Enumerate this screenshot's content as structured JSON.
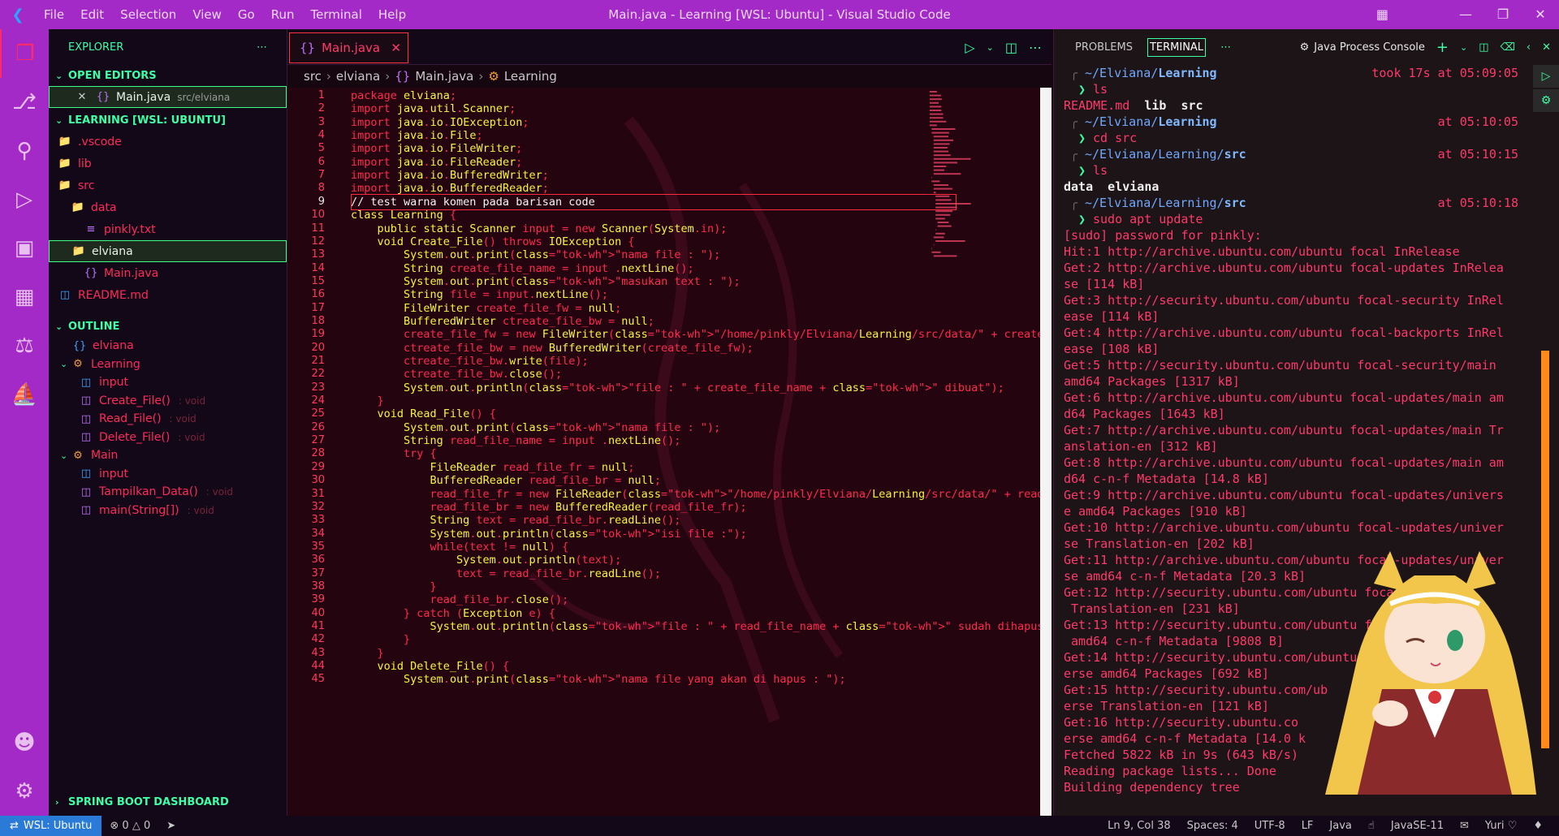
{
  "titlebar": {
    "menu": [
      "File",
      "Edit",
      "Selection",
      "View",
      "Go",
      "Run",
      "Terminal",
      "Help"
    ],
    "title": "Main.java - Learning [WSL: Ubuntu] - Visual Studio Code"
  },
  "sidebar": {
    "header": "EXPLORER",
    "open_editors": {
      "title": "OPEN EDITORS",
      "items": [
        {
          "name": "Main.java",
          "path": "src/elviana"
        }
      ]
    },
    "workspace": {
      "title": "LEARNING [WSL: UBUNTU]",
      "items": [
        {
          "label": ".vscode",
          "depth": 0
        },
        {
          "label": "lib",
          "depth": 0
        },
        {
          "label": "src",
          "depth": 0
        },
        {
          "label": "data",
          "depth": 1
        },
        {
          "label": "pinkly.txt",
          "depth": 2
        },
        {
          "label": "elviana",
          "depth": 1
        },
        {
          "label": "Main.java",
          "depth": 2
        },
        {
          "label": "README.md",
          "depth": 0
        }
      ]
    },
    "outline": {
      "title": "OUTLINE",
      "items": [
        {
          "label": "elviana",
          "type": ""
        },
        {
          "label": "Learning",
          "type": ""
        },
        {
          "label": "input",
          "type": ""
        },
        {
          "label": "Create_File()",
          "type": ": void"
        },
        {
          "label": "Read_File()",
          "type": ": void"
        },
        {
          "label": "Delete_File()",
          "type": ": void"
        },
        {
          "label": "Main",
          "type": ""
        },
        {
          "label": "input",
          "type": ""
        },
        {
          "label": "Tampilkan_Data()",
          "type": ": void"
        },
        {
          "label": "main(String[])",
          "type": ": void"
        }
      ]
    },
    "spring": "SPRING BOOT DASHBOARD"
  },
  "editor": {
    "tab": "Main.java",
    "breadcrumb": [
      "src",
      "elviana",
      "Main.java",
      "Learning"
    ],
    "current_line": 9,
    "lines": [
      "package elviana;",
      "import java.util.Scanner;",
      "import java.io.IOException;",
      "import java.io.File;",
      "import java.io.FileWriter;",
      "import java.io.FileReader;",
      "import java.io.BufferedWriter;",
      "import java.io.BufferedReader;",
      "// test warna komen pada barisan code",
      "class Learning {",
      "    public static Scanner input = new Scanner(System.in);",
      "    void Create_File() throws IOException {",
      "        System.out.print(\"nama file : \");",
      "        String create_file_name = input .nextLine();",
      "        System.out.print(\"masukan text : \");",
      "        String file = input.nextLine();",
      "        FileWriter create_file_fw = null;",
      "        BufferedWriter ctreate_file_bw = null;",
      "        create_file_fw = new FileWriter(\"/home/pinkly/Elviana/Learning/src/data/\" + create_",
      "        ctreate_file_bw = new BufferedWriter(create_file_fw);",
      "        ctreate_file_bw.write(file);",
      "        ctreate_file_bw.close();",
      "        System.out.println(\"file : \" + create_file_name + \" dibuat\");",
      "    }",
      "    void Read_File() {",
      "        System.out.print(\"nama file : \");",
      "        String read_file_name = input .nextLine();",
      "        try {",
      "            FileReader read_file_fr = null;",
      "            BufferedReader read_file_br = null;",
      "            read_file_fr = new FileReader(\"/home/pinkly/Elviana/Learning/src/data/\" + read_",
      "            read_file_br = new BufferedReader(read_file_fr);",
      "            String text = read_file_br.readLine();",
      "            System.out.println(\"isi file :\");",
      "            while(text != null) {",
      "                System.out.println(text);",
      "                text = read_file_br.readLine();",
      "            }",
      "            read_file_br.close();",
      "        } catch (Exception e) {",
      "            System.out.println(\"file : \" + read_file_name + \" sudah dihapus\");",
      "        }",
      "    }",
      "    void Delete_File() {",
      "        System.out.print(\"nama file yang akan di hapus : \");"
    ]
  },
  "panel": {
    "tabs": [
      "PROBLEMS",
      "TERMINAL"
    ],
    "active_tab": "TERMINAL",
    "console": "Java Process Console",
    "terminal": [
      {
        "kind": "path",
        "dir": "~/Elviana/",
        "bold": "Learning",
        "time": "took 17s at 05:09:05"
      },
      {
        "kind": "cmd",
        "text": "ls"
      },
      {
        "kind": "ls",
        "text": "README.md  ",
        "bold": "lib  src"
      },
      {
        "kind": "path",
        "dir": "~/Elviana/",
        "bold": "Learning",
        "time": "at 05:10:05"
      },
      {
        "kind": "cmd",
        "text": "cd src"
      },
      {
        "kind": "path",
        "dir": "~/Elviana/Learning/",
        "bold": "src",
        "time": "at 05:10:15"
      },
      {
        "kind": "cmd",
        "text": "ls"
      },
      {
        "kind": "ls",
        "text": "",
        "bold": "data  elviana"
      },
      {
        "kind": "path",
        "dir": "~/Elviana/Learning/",
        "bold": "src",
        "time": "at 05:10:18"
      },
      {
        "kind": "cmd",
        "text": "sudo apt update"
      },
      {
        "kind": "out",
        "text": "[sudo] password for pinkly:"
      },
      {
        "kind": "out",
        "text": "Hit:1 http://archive.ubuntu.com/ubuntu focal InRelease"
      },
      {
        "kind": "out",
        "text": "Get:2 http://archive.ubuntu.com/ubuntu focal-updates InRelea"
      },
      {
        "kind": "out",
        "text": "se [114 kB]"
      },
      {
        "kind": "out",
        "text": "Get:3 http://security.ubuntu.com/ubuntu focal-security InRel"
      },
      {
        "kind": "out",
        "text": "ease [114 kB]"
      },
      {
        "kind": "out",
        "text": "Get:4 http://archive.ubuntu.com/ubuntu focal-backports InRel"
      },
      {
        "kind": "out",
        "text": "ease [108 kB]"
      },
      {
        "kind": "out",
        "text": "Get:5 http://security.ubuntu.com/ubuntu focal-security/main"
      },
      {
        "kind": "out",
        "text": "amd64 Packages [1317 kB]"
      },
      {
        "kind": "out",
        "text": "Get:6 http://archive.ubuntu.com/ubuntu focal-updates/main am"
      },
      {
        "kind": "out",
        "text": "d64 Packages [1643 kB]"
      },
      {
        "kind": "out",
        "text": "Get:7 http://archive.ubuntu.com/ubuntu focal-updates/main Tr"
      },
      {
        "kind": "out",
        "text": "anslation-en [312 kB]"
      },
      {
        "kind": "out",
        "text": "Get:8 http://archive.ubuntu.com/ubuntu focal-updates/main am"
      },
      {
        "kind": "out",
        "text": "d64 c-n-f Metadata [14.8 kB]"
      },
      {
        "kind": "out",
        "text": "Get:9 http://archive.ubuntu.com/ubuntu focal-updates/univers"
      },
      {
        "kind": "out",
        "text": "e amd64 Packages [910 kB]"
      },
      {
        "kind": "out",
        "text": "Get:10 http://archive.ubuntu.com/ubuntu focal-updates/univer"
      },
      {
        "kind": "out",
        "text": "se Translation-en [202 kB]"
      },
      {
        "kind": "out",
        "text": "Get:11 http://archive.ubuntu.com/ubuntu focal-updates/univer"
      },
      {
        "kind": "out",
        "text": "se amd64 c-n-f Metadata [20.3 kB]"
      },
      {
        "kind": "out",
        "text": "Get:12 http://security.ubuntu.com/ubuntu focal-"
      },
      {
        "kind": "out",
        "text": " Translation-en [231 kB]"
      },
      {
        "kind": "out",
        "text": "Get:13 http://security.ubuntu.com/ubuntu focal"
      },
      {
        "kind": "out",
        "text": " amd64 c-n-f Metadata [9808 B]"
      },
      {
        "kind": "out",
        "text": "Get:14 http://security.ubuntu.com/ubuntu foca"
      },
      {
        "kind": "out",
        "text": "erse amd64 Packages [692 kB]"
      },
      {
        "kind": "out",
        "text": "Get:15 http://security.ubuntu.com/ub"
      },
      {
        "kind": "out",
        "text": "erse Translation-en [121 kB]"
      },
      {
        "kind": "out",
        "text": "Get:16 http://security.ubuntu.co"
      },
      {
        "kind": "out",
        "text": "erse amd64 c-n-f Metadata [14.0 k"
      },
      {
        "kind": "out",
        "text": "Fetched 5822 kB in 9s (643 kB/s)"
      },
      {
        "kind": "out",
        "text": "Reading package lists... Done"
      },
      {
        "kind": "out",
        "text": "Building dependency tree"
      }
    ]
  },
  "statusbar": {
    "remote": "WSL: Ubuntu",
    "errors": "0",
    "warnings": "0",
    "position": "Ln 9, Col 38",
    "spaces": "Spaces: 4",
    "encoding": "UTF-8",
    "eol": "LF",
    "language": "Java",
    "runtime": "JavaSE-11",
    "user": "Yuri"
  },
  "colors": {
    "titlebar": "#a32ac7",
    "accent": "#3dffa6",
    "code_text": "#ff2a50",
    "editor_bg": "#24040f"
  }
}
